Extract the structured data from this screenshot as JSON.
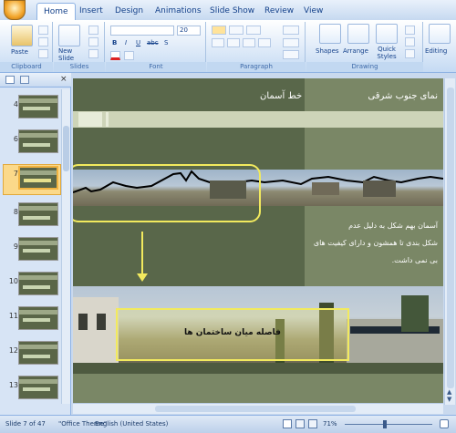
{
  "ribbon_tabs": [
    "Home",
    "Insert",
    "Design",
    "Animations",
    "Slide Show",
    "Review",
    "View"
  ],
  "ribbon": {
    "paste_label": "Paste",
    "new_slide_label": "New Slide",
    "font_size": "20",
    "shapes_label": "Shapes",
    "arrange_label": "Arrange",
    "quick_styles_label": "Quick Styles",
    "editing_label": "Editing",
    "groups": {
      "clipboard": "Clipboard",
      "slides": "Slides",
      "font": "Font",
      "paragraph": "Paragraph",
      "drawing": "Drawing"
    },
    "bold": "B",
    "italic": "I",
    "underline": "U",
    "strike": "abc",
    "shadow": "S"
  },
  "slide_panel": {
    "slides": [
      {
        "num": "4"
      },
      {
        "num": "6"
      },
      {
        "num": "7"
      },
      {
        "num": "8"
      },
      {
        "num": "9"
      },
      {
        "num": "10"
      },
      {
        "num": "11"
      },
      {
        "num": "12"
      },
      {
        "num": "13"
      }
    ],
    "selected_num": "7"
  },
  "slide": {
    "header_left": "خط آسمان",
    "header_right": "نمای جنوب شرقی",
    "body_text": [
      "آسمان بهم شکل به دلیل عدم",
      "شکل بندی تا همشون و دارای کیفیت های",
      "بی نمی داشت."
    ],
    "callout_text": "فاصله میان ساختمان ها"
  },
  "status": {
    "slide_count": "Slide 7 of 47",
    "theme": "\"Office Theme\"",
    "language": "English (United States)",
    "zoom": "71%"
  }
}
